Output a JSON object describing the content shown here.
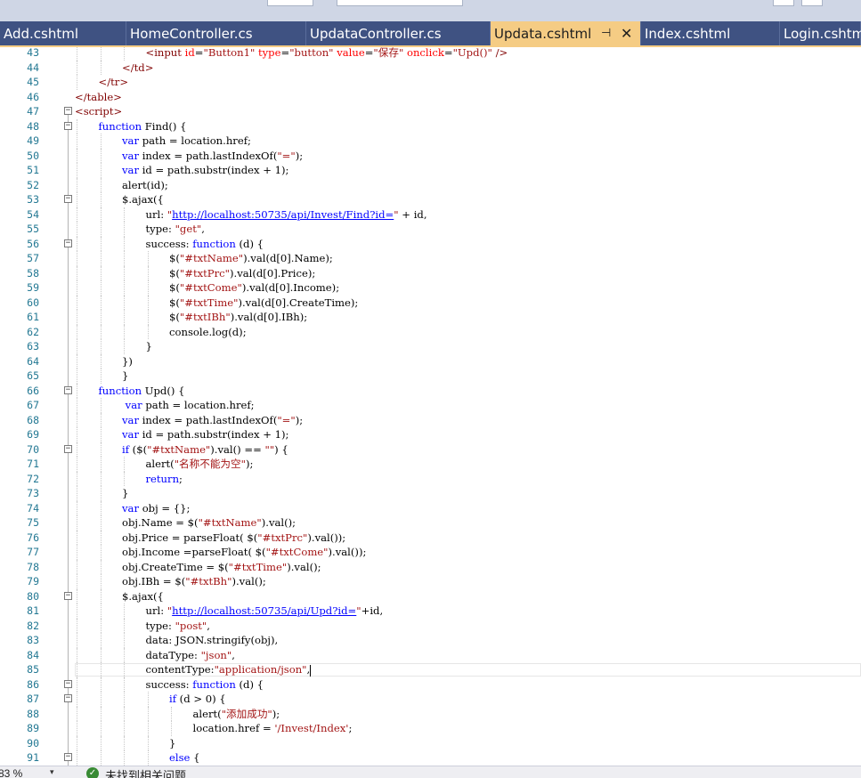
{
  "tabs": [
    {
      "label": "Add.cshtml",
      "active": false
    },
    {
      "label": "HomeController.cs",
      "active": false
    },
    {
      "label": "UpdataController.cs",
      "active": false
    },
    {
      "label": "Updata.cshtml",
      "active": true,
      "pin_icon": "⊣",
      "close_icon": "✕"
    },
    {
      "label": "Index.cshtml",
      "active": false
    },
    {
      "label": "Login.cshtml",
      "active": false
    }
  ],
  "code_lines": [
    {
      "n": "43",
      "indent": 3,
      "tokens": [
        [
          "tag",
          "<input "
        ],
        [
          "attr",
          "id"
        ],
        [
          "",
          "="
        ],
        [
          "str",
          "\"Button1\""
        ],
        [
          "",
          " "
        ],
        [
          "attr",
          "type"
        ],
        [
          "",
          "="
        ],
        [
          "str",
          "\"button\""
        ],
        [
          "",
          " "
        ],
        [
          "attr",
          "value"
        ],
        [
          "",
          "="
        ],
        [
          "str",
          "\"保存\""
        ],
        [
          "",
          " "
        ],
        [
          "attr",
          "onclick"
        ],
        [
          "",
          "="
        ],
        [
          "str",
          "\"Upd()\""
        ],
        [
          "",
          " "
        ],
        [
          "tag",
          "/>"
        ]
      ]
    },
    {
      "n": "44",
      "indent": 2,
      "tokens": [
        [
          "tag",
          "</td>"
        ]
      ]
    },
    {
      "n": "45",
      "indent": 1,
      "tokens": [
        [
          "tag",
          "</tr>"
        ]
      ]
    },
    {
      "n": "46",
      "indent": 0,
      "tokens": [
        [
          "tag",
          "</table>"
        ]
      ]
    },
    {
      "n": "47",
      "indent": 0,
      "fold": true,
      "tokens": [
        [
          "tag",
          "<script>"
        ]
      ]
    },
    {
      "n": "48",
      "indent": 1,
      "fold": true,
      "tokens": [
        [
          "kw",
          "function"
        ],
        [
          "",
          " Find() {"
        ]
      ]
    },
    {
      "n": "49",
      "indent": 2,
      "tokens": [
        [
          "kw",
          "var"
        ],
        [
          "",
          " path = location.href;"
        ]
      ]
    },
    {
      "n": "50",
      "indent": 2,
      "tokens": [
        [
          "kw",
          "var"
        ],
        [
          "",
          " index = path.lastIndexOf("
        ],
        [
          "str",
          "\"=\""
        ],
        [
          "",
          ");"
        ]
      ]
    },
    {
      "n": "51",
      "indent": 2,
      "tokens": [
        [
          "kw",
          "var"
        ],
        [
          "",
          " id = path.substr(index + 1);"
        ]
      ]
    },
    {
      "n": "52",
      "indent": 2,
      "tokens": [
        [
          "",
          "alert(id);"
        ]
      ]
    },
    {
      "n": "53",
      "indent": 2,
      "fold": true,
      "tokens": [
        [
          "",
          "$.ajax({"
        ]
      ]
    },
    {
      "n": "54",
      "indent": 3,
      "tokens": [
        [
          "",
          "url: "
        ],
        [
          "str",
          "\""
        ],
        [
          "lnk",
          "http://localhost:50735/api/Invest/Find?id="
        ],
        [
          "str",
          "\""
        ],
        [
          "",
          " + id,"
        ]
      ]
    },
    {
      "n": "55",
      "indent": 3,
      "tokens": [
        [
          "",
          "type: "
        ],
        [
          "str",
          "\"get\""
        ],
        [
          "",
          ","
        ]
      ]
    },
    {
      "n": "56",
      "indent": 3,
      "fold": true,
      "tokens": [
        [
          "",
          "success: "
        ],
        [
          "kw",
          "function"
        ],
        [
          "",
          " (d) {"
        ]
      ]
    },
    {
      "n": "57",
      "indent": 4,
      "tokens": [
        [
          "",
          "$("
        ],
        [
          "str",
          "\"#txtName\""
        ],
        [
          "",
          ").val(d[0].Name);"
        ]
      ]
    },
    {
      "n": "58",
      "indent": 4,
      "tokens": [
        [
          "",
          "$("
        ],
        [
          "str",
          "\"#txtPrc\""
        ],
        [
          "",
          ").val(d[0].Price);"
        ]
      ]
    },
    {
      "n": "59",
      "indent": 4,
      "tokens": [
        [
          "",
          "$("
        ],
        [
          "str",
          "\"#txtCome\""
        ],
        [
          "",
          ").val(d[0].Income);"
        ]
      ]
    },
    {
      "n": "60",
      "indent": 4,
      "tokens": [
        [
          "",
          "$("
        ],
        [
          "str",
          "\"#txtTime\""
        ],
        [
          "",
          ").val(d[0].CreateTime);"
        ]
      ]
    },
    {
      "n": "61",
      "indent": 4,
      "tokens": [
        [
          "",
          "$("
        ],
        [
          "str",
          "\"#txtIBh\""
        ],
        [
          "",
          ").val(d[0].IBh);"
        ]
      ]
    },
    {
      "n": "62",
      "indent": 4,
      "tokens": [
        [
          "",
          "console.log(d);"
        ]
      ]
    },
    {
      "n": "63",
      "indent": 3,
      "tokens": [
        [
          "",
          "}"
        ]
      ]
    },
    {
      "n": "64",
      "indent": 2,
      "tokens": [
        [
          "",
          "})"
        ]
      ]
    },
    {
      "n": "65",
      "indent": 2,
      "tokens": [
        [
          "",
          "}"
        ]
      ]
    },
    {
      "n": "66",
      "indent": 1,
      "fold": true,
      "tokens": [
        [
          "kw",
          "function"
        ],
        [
          "",
          " Upd() {"
        ]
      ]
    },
    {
      "n": "67",
      "indent": 2,
      "tokens": [
        [
          "kw",
          " var"
        ],
        [
          "",
          " path = location.href;"
        ]
      ]
    },
    {
      "n": "68",
      "indent": 2,
      "tokens": [
        [
          "kw",
          "var"
        ],
        [
          "",
          " index = path.lastIndexOf("
        ],
        [
          "str",
          "\"=\""
        ],
        [
          "",
          ");"
        ]
      ]
    },
    {
      "n": "69",
      "indent": 2,
      "tokens": [
        [
          "kw",
          "var"
        ],
        [
          "",
          " id = path.substr(index + 1);"
        ]
      ]
    },
    {
      "n": "70",
      "indent": 2,
      "fold": true,
      "tokens": [
        [
          "kw",
          "if"
        ],
        [
          "",
          " ($("
        ],
        [
          "str",
          "\"#txtName\""
        ],
        [
          "",
          ").val() == "
        ],
        [
          "str",
          "\"\""
        ],
        [
          "",
          ") {"
        ]
      ]
    },
    {
      "n": "71",
      "indent": 3,
      "tokens": [
        [
          "",
          "alert("
        ],
        [
          "str",
          "\"名称不能为空\""
        ],
        [
          "",
          ");"
        ]
      ]
    },
    {
      "n": "72",
      "indent": 3,
      "tokens": [
        [
          "kw",
          "return"
        ],
        [
          "",
          ";"
        ]
      ]
    },
    {
      "n": "73",
      "indent": 2,
      "tokens": [
        [
          "",
          "}"
        ]
      ]
    },
    {
      "n": "74",
      "indent": 2,
      "tokens": [
        [
          "kw",
          "var"
        ],
        [
          "",
          " obj = {};"
        ]
      ]
    },
    {
      "n": "75",
      "indent": 2,
      "tokens": [
        [
          "",
          "obj.Name = $("
        ],
        [
          "str",
          "\"#txtName\""
        ],
        [
          "",
          ").val();"
        ]
      ]
    },
    {
      "n": "76",
      "indent": 2,
      "tokens": [
        [
          "",
          "obj.Price = parseFloat( $("
        ],
        [
          "str",
          "\"#txtPrc\""
        ],
        [
          "",
          ").val());"
        ]
      ]
    },
    {
      "n": "77",
      "indent": 2,
      "tokens": [
        [
          "",
          "obj.Income =parseFloat( $("
        ],
        [
          "str",
          "\"#txtCome\""
        ],
        [
          "",
          ").val());"
        ]
      ]
    },
    {
      "n": "78",
      "indent": 2,
      "tokens": [
        [
          "",
          "obj.CreateTime = $("
        ],
        [
          "str",
          "\"#txtTime\""
        ],
        [
          "",
          ").val();"
        ]
      ]
    },
    {
      "n": "79",
      "indent": 2,
      "tokens": [
        [
          "",
          "obj.IBh = $("
        ],
        [
          "str",
          "\"#txtBh\""
        ],
        [
          "",
          ").val();"
        ]
      ]
    },
    {
      "n": "80",
      "indent": 2,
      "fold": true,
      "tokens": [
        [
          "",
          "$.ajax({"
        ]
      ]
    },
    {
      "n": "81",
      "indent": 3,
      "tokens": [
        [
          "",
          "url: "
        ],
        [
          "str",
          "\""
        ],
        [
          "lnk",
          "http://localhost:50735/api/Upd?id="
        ],
        [
          "str",
          "\""
        ],
        [
          "",
          "+id,"
        ]
      ]
    },
    {
      "n": "82",
      "indent": 3,
      "tokens": [
        [
          "",
          "type: "
        ],
        [
          "str",
          "\"post\""
        ],
        [
          "",
          ","
        ]
      ]
    },
    {
      "n": "83",
      "indent": 3,
      "tokens": [
        [
          "",
          "data: JSON.stringify(obj),"
        ]
      ]
    },
    {
      "n": "84",
      "indent": 3,
      "tokens": [
        [
          "",
          "dataType: "
        ],
        [
          "str",
          "\"json\""
        ],
        [
          "",
          ","
        ]
      ]
    },
    {
      "n": "85",
      "indent": 3,
      "current": true,
      "tokens": [
        [
          "",
          "contentType:"
        ],
        [
          "str",
          "\"application/json\""
        ],
        [
          "",
          ","
        ]
      ]
    },
    {
      "n": "86",
      "indent": 3,
      "fold": true,
      "tokens": [
        [
          "",
          "success: "
        ],
        [
          "kw",
          "function"
        ],
        [
          "",
          " (d) {"
        ]
      ]
    },
    {
      "n": "87",
      "indent": 4,
      "fold": true,
      "tokens": [
        [
          "kw",
          "if"
        ],
        [
          "",
          " (d > 0) {"
        ]
      ]
    },
    {
      "n": "88",
      "indent": 5,
      "tokens": [
        [
          "",
          "alert("
        ],
        [
          "str",
          "\"添加成功\""
        ],
        [
          "",
          ");"
        ]
      ]
    },
    {
      "n": "89",
      "indent": 5,
      "tokens": [
        [
          "",
          "location.href = "
        ],
        [
          "str",
          "'/Invest/Index'"
        ],
        [
          "",
          ";"
        ]
      ]
    },
    {
      "n": "90",
      "indent": 4,
      "tokens": [
        [
          "",
          "}"
        ]
      ]
    },
    {
      "n": "91",
      "indent": 4,
      "fold": true,
      "tokens": [
        [
          "kw",
          "else"
        ],
        [
          "",
          " {"
        ]
      ]
    }
  ],
  "status_bar": {
    "zoom": "83 %",
    "zoom_dropdown_icon": "▾",
    "ok_icon": "✓",
    "issues_text": "未找到相关问题"
  },
  "colors": {
    "tab_bar": "#3f5282",
    "active_tab": "#f5cc84",
    "keyword": "#0000ff",
    "string": "#a31515",
    "html_tag": "#800000",
    "html_attribute": "#ff0000",
    "line_number": "#237893"
  }
}
